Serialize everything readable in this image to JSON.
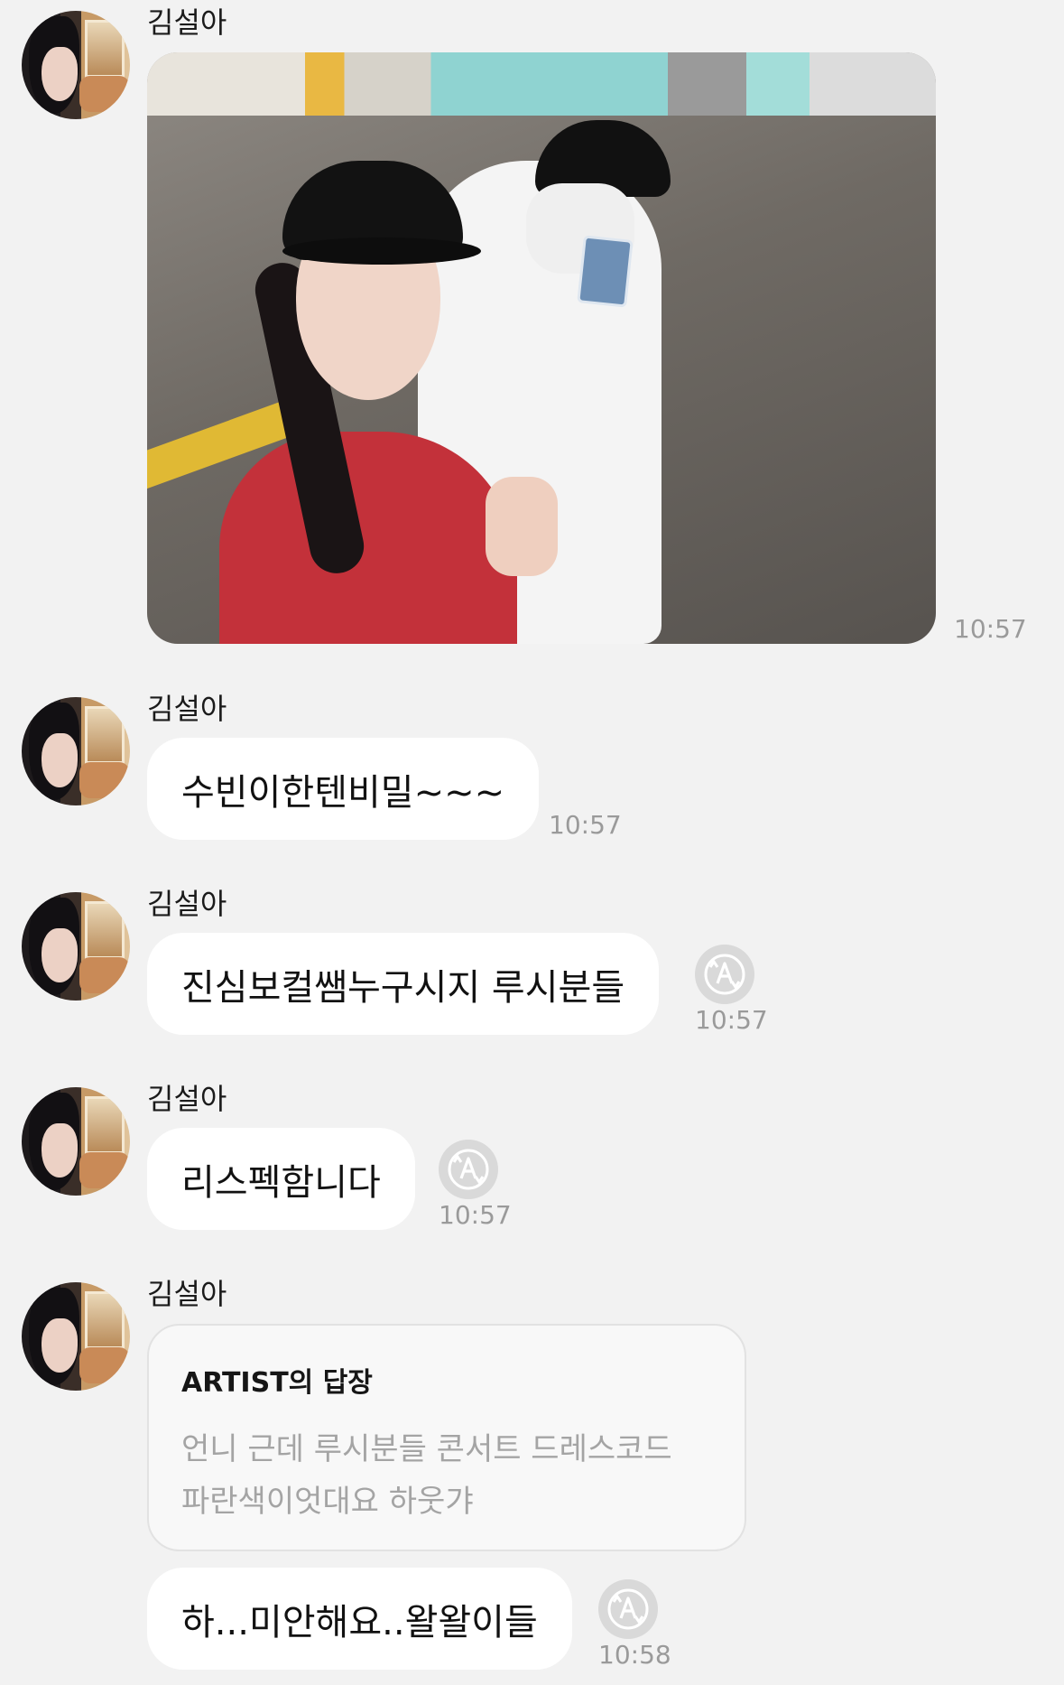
{
  "messages": [
    {
      "sender": "김설아",
      "type": "photo",
      "time": "10:57"
    },
    {
      "sender": "김설아",
      "text": "수빈이한텐비밀~~~",
      "time": "10:57"
    },
    {
      "sender": "김설아",
      "text": "진심보컬쌤누구시지 루시분들",
      "time": "10:57"
    },
    {
      "sender": "김설아",
      "text": "리스펙함니다",
      "time": "10:57"
    },
    {
      "sender": "김설아",
      "reply": {
        "title": "ARTIST의 답장",
        "body": "언니 근데 루시분들 콘서트 드레스코드\n파란색이엇대요 하웃갸"
      },
      "text": "하...미안해요..왈왈이들",
      "time": "10:58"
    }
  ],
  "icons": {
    "avatar": "avatar-icon",
    "translate": "translate-icon"
  },
  "colors": {
    "background": "#f2f2f2",
    "bubble": "#ffffff",
    "time": "#9a9a9a",
    "translate_button": "#d9d9d9"
  }
}
